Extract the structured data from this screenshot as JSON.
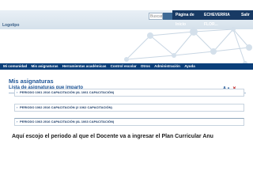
{
  "topbar": {
    "logo_text": "Logotipo",
    "search_placeholder": "Buscar",
    "nav": [
      "Página de Inicio",
      "ECHEVERRIA FLOR...",
      "Salir"
    ]
  },
  "menubar": {
    "items": [
      "Mi comunidad",
      "Mis asignaturas",
      "Herramientas académicas",
      "Control escolar",
      "Otros",
      "Administración",
      "Ayuda"
    ]
  },
  "main": {
    "title": "Mis asignaturas",
    "subtitle": "Lista de asignaturas que imparto",
    "tools": [
      "A",
      "A"
    ],
    "periods": [
      "PERIODO 1061 2016 CAPACITACIÓN (4L 1061 CAPACITACIÓN)",
      "PERIODO 1062 2016 CAPACITACIÓN (2 1062 CAPACITACIÓN)",
      "PERIODO 1063 2016 CAPACITACIÓN (4L 1063 CAPACITACIÓN)"
    ]
  },
  "caption": "Aquí escojo el periodo al que el Docente va a ingresar el Plan Curricular Anu",
  "colors": {
    "navy": "#183a64",
    "menubar": "#0b3f7a",
    "heading": "#1f5596"
  }
}
